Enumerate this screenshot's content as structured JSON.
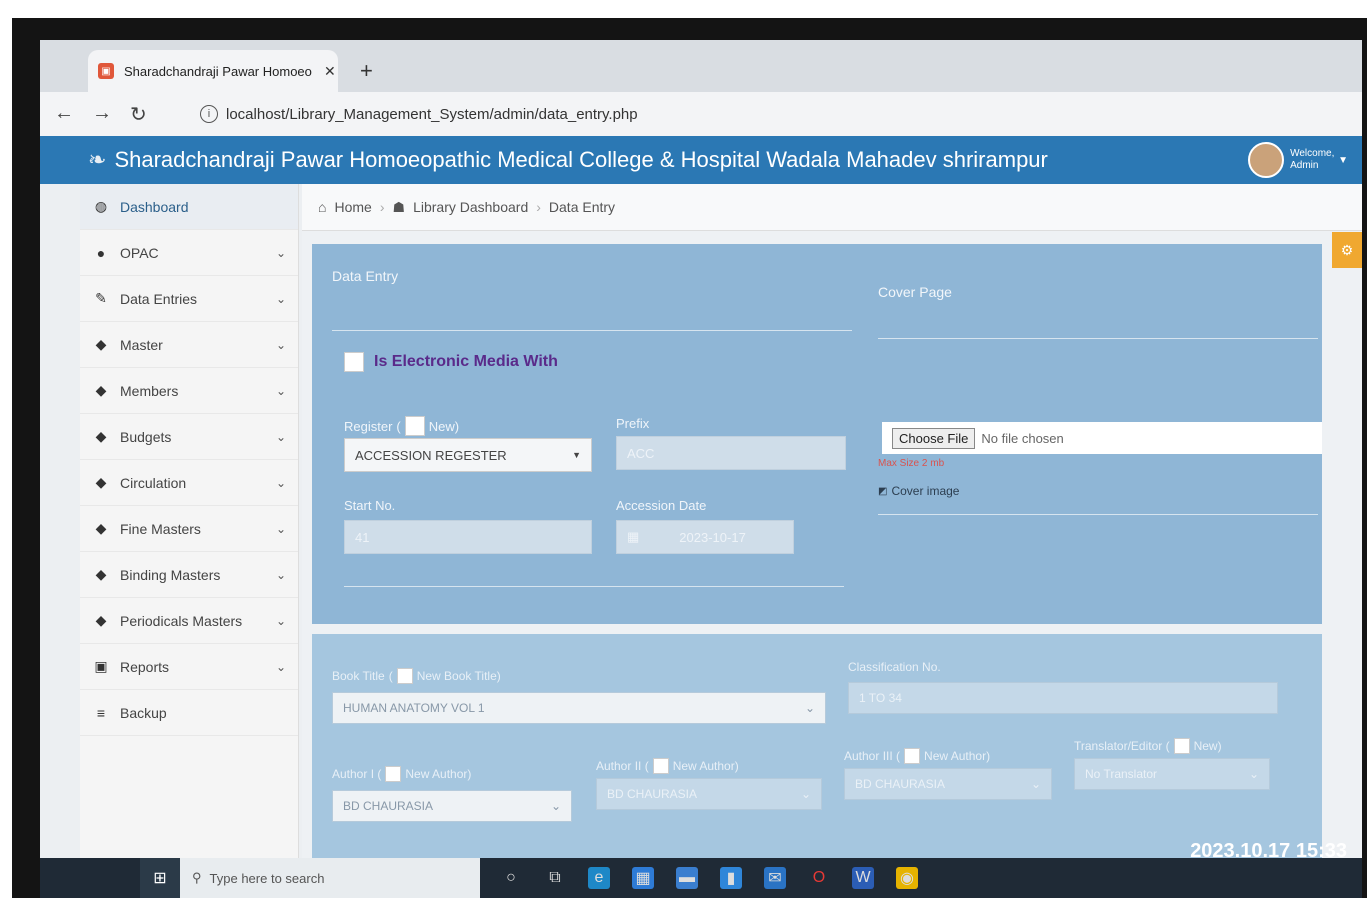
{
  "browser": {
    "tab_title": "Sharadchandraji Pawar Homoeo",
    "tab_close": "✕",
    "new_tab": "+",
    "url": "localhost/Library_Management_System/admin/data_entry.php"
  },
  "header": {
    "title": "Sharadchandraji Pawar Homoeopathic Medical College & Hospital Wadala Mahadev shrirampur",
    "user_label": "Welcome, Admin"
  },
  "sidebar": {
    "items": [
      {
        "label": "Dashboard",
        "icon": "dashboard-icon"
      },
      {
        "label": "OPAC",
        "icon": "user-icon"
      },
      {
        "label": "Data Entries",
        "icon": "pencil-icon"
      },
      {
        "label": "Master",
        "icon": "tag-icon"
      },
      {
        "label": "Members",
        "icon": "tag-icon"
      },
      {
        "label": "Budgets",
        "icon": "tag-icon"
      },
      {
        "label": "Circulation",
        "icon": "tag-icon"
      },
      {
        "label": "Fine Masters",
        "icon": "tag-icon"
      },
      {
        "label": "Binding Masters",
        "icon": "tag-icon"
      },
      {
        "label": "Periodicals Masters",
        "icon": "tag-icon"
      },
      {
        "label": "Reports",
        "icon": "report-icon"
      },
      {
        "label": "Backup",
        "icon": "database-icon"
      }
    ]
  },
  "breadcrumb": {
    "home": "Home",
    "library_dashboard": "Library Dashboard",
    "current": "Data Entry"
  },
  "form": {
    "data_entry_label": "Data Entry",
    "cover_page_label": "Cover Page",
    "electronic_media_label": "Is Electronic Media With",
    "register_label": "Register",
    "register_new_label": "New)",
    "register_value": "ACCESSION REGESTER",
    "prefix_label": "Prefix",
    "prefix_value": "ACC",
    "start_no_label": "Start No.",
    "start_no_value": "41",
    "accession_date_label": "Accession Date",
    "accession_date_value": "2023-10-17",
    "file_button": "Choose File",
    "file_text": "No file chosen",
    "max_size": "Max Size 2 mb",
    "cover_image_alt": "Cover image"
  },
  "form2": {
    "book_title_label": "Book Title",
    "book_title_new": "New Book Title)",
    "book_title_value": "HUMAN ANATOMY VOL 1",
    "classification_label": "Classification No.",
    "classification_value": "1 TO 34",
    "author1_label": "Author I (",
    "author1_new": "New Author)",
    "author1_value": "BD CHAURASIA",
    "author2_label": "Author II (",
    "author2_new": "New Author)",
    "author2_value": "BD CHAURASIA",
    "author3_label": "Author III (",
    "author3_new": "New Author)",
    "author3_value": "BD CHAURASIA",
    "translator_label": "Translator/Editor (",
    "translator_new": "New)",
    "translator_value": "No Translator"
  },
  "taskbar": {
    "search_placeholder": "Type here to search"
  },
  "photo_timestamp": "2023.10.17 15:33",
  "colors": {
    "header_blue": "#2b78b4",
    "panel_blue": "#8fb6d6",
    "accent_orange": "#f0a830",
    "label_purple": "#5a2a8a"
  }
}
